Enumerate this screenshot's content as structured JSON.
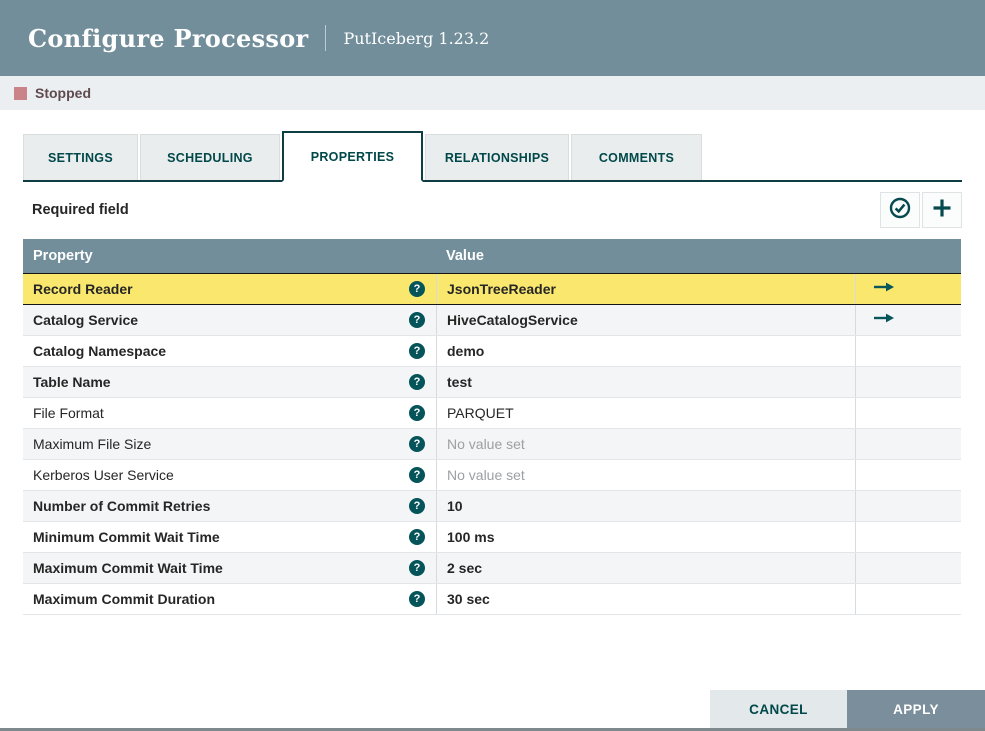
{
  "dialog": {
    "title": "Configure Processor",
    "subtitle": "PutIceberg 1.23.2"
  },
  "status": {
    "label": "Stopped",
    "color": "#C98389"
  },
  "tabs": [
    {
      "label": "SETTINGS",
      "active": false
    },
    {
      "label": "SCHEDULING",
      "active": false
    },
    {
      "label": "PROPERTIES",
      "active": true
    },
    {
      "label": "RELATIONSHIPS",
      "active": false
    },
    {
      "label": "COMMENTS",
      "active": false
    }
  ],
  "properties_panel": {
    "required_field_label": "Required field",
    "verify_button_icon": "check-circle-icon",
    "add_button_icon": "plus-icon"
  },
  "table": {
    "columns": [
      "Property",
      "Value"
    ],
    "help_glyph": "?",
    "rows": [
      {
        "property": "Record Reader",
        "property_bold": true,
        "value": "JsonTreeReader",
        "value_style": "set",
        "has_arrow": true,
        "selected": true
      },
      {
        "property": "Catalog Service",
        "property_bold": true,
        "value": "HiveCatalogService",
        "value_style": "set",
        "has_arrow": true,
        "selected": false
      },
      {
        "property": "Catalog Namespace",
        "property_bold": true,
        "value": "demo",
        "value_style": "set",
        "has_arrow": false,
        "selected": false
      },
      {
        "property": "Table Name",
        "property_bold": true,
        "value": "test",
        "value_style": "set",
        "has_arrow": false,
        "selected": false
      },
      {
        "property": "File Format",
        "property_bold": false,
        "value": "PARQUET",
        "value_style": "default",
        "has_arrow": false,
        "selected": false
      },
      {
        "property": "Maximum File Size",
        "property_bold": false,
        "value": "No value set",
        "value_style": "unset",
        "has_arrow": false,
        "selected": false
      },
      {
        "property": "Kerberos User Service",
        "property_bold": false,
        "value": "No value set",
        "value_style": "unset",
        "has_arrow": false,
        "selected": false
      },
      {
        "property": "Number of Commit Retries",
        "property_bold": true,
        "value": "10",
        "value_style": "set",
        "has_arrow": false,
        "selected": false
      },
      {
        "property": "Minimum Commit Wait Time",
        "property_bold": true,
        "value": "100 ms",
        "value_style": "set",
        "has_arrow": false,
        "selected": false
      },
      {
        "property": "Maximum Commit Wait Time",
        "property_bold": true,
        "value": "2 sec",
        "value_style": "set",
        "has_arrow": false,
        "selected": false
      },
      {
        "property": "Maximum Commit Duration",
        "property_bold": true,
        "value": "30 sec",
        "value_style": "set",
        "has_arrow": false,
        "selected": false
      }
    ]
  },
  "footer": {
    "cancel_label": "CANCEL",
    "apply_label": "APPLY"
  },
  "colors": {
    "header_background": "#728E9B",
    "accent_teal": "#004849",
    "selected_row": "#F9E86D",
    "status_bar_background": "#ECEFF1"
  }
}
